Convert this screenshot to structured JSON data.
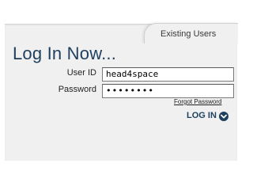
{
  "tabs": {
    "existing_users": "Existing Users"
  },
  "form": {
    "title": "Log In Now...",
    "user_id_label": "User ID",
    "user_id_value": "head4space",
    "password_label": "Password",
    "password_value": "••••••••",
    "forgot_password": "Forgot Password",
    "login_button": "LOG IN"
  },
  "icons": {
    "login_arrow": "circle-chevron-down-icon"
  },
  "colors": {
    "title": "#1e3f5e",
    "panel": "#f0f0f0"
  }
}
